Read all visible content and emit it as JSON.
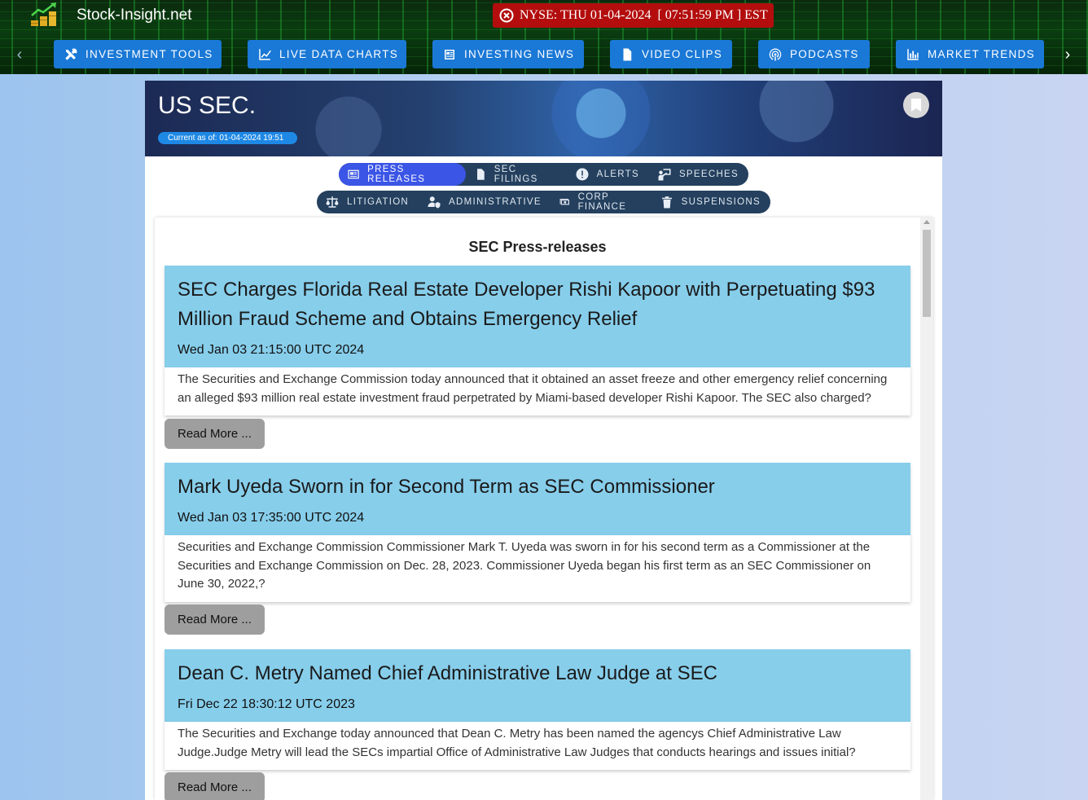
{
  "header": {
    "brand": "Stock-Insight.net",
    "clock_text": "NYSE: THU 01-04-2024  [ 07:51:59 PM ] EST",
    "colors": {
      "clock_bg": "#b30d0d",
      "nav_button": "#1a78d6"
    }
  },
  "nav": {
    "left_arrow": "‹",
    "right_arrow": "›",
    "items": [
      {
        "label": "Investment Tools",
        "icon": "tools-icon"
      },
      {
        "label": "Live Data Charts",
        "icon": "line-chart-icon"
      },
      {
        "label": "Investing News",
        "icon": "newspaper-icon"
      },
      {
        "label": "Video Clips",
        "icon": "video-file-icon"
      },
      {
        "label": "Podcasts",
        "icon": "podcast-icon"
      },
      {
        "label": "Market Trends",
        "icon": "bar-chart-icon"
      }
    ]
  },
  "page": {
    "title": "US SEC.",
    "as_of": "Current as of: 01-04-2024 19:51"
  },
  "tabs": {
    "row1": [
      {
        "label": "Press Releases",
        "icon": "newspaper-icon",
        "active": true
      },
      {
        "label": "SEC Filings",
        "icon": "file-upload-icon",
        "active": false
      },
      {
        "label": "Alerts",
        "icon": "alert-icon",
        "active": false
      },
      {
        "label": "Speeches",
        "icon": "speaker-icon",
        "active": false
      }
    ],
    "row2": [
      {
        "label": "Litigation",
        "icon": "scale-icon",
        "active": false
      },
      {
        "label": "Administrative",
        "icon": "user-shield-icon",
        "active": false
      },
      {
        "label": "Corp Finance",
        "icon": "cash-icon",
        "active": false
      },
      {
        "label": "Suspensions",
        "icon": "trash-icon",
        "active": false
      }
    ]
  },
  "feed": {
    "title": "SEC Press-releases",
    "read_more_label": "Read More ...",
    "items": [
      {
        "title": "SEC Charges Florida Real Estate Developer Rishi Kapoor with Perpetuating $93 Million Fraud Scheme and Obtains Emergency Relief",
        "date": "Wed Jan 03 21:15:00 UTC 2024",
        "summary": "The Securities and Exchange Commission today announced that it obtained an asset freeze and other emergency relief concerning an alleged $93 million real estate investment fraud perpetrated by Miami-based developer Rishi Kapoor. The SEC also charged?"
      },
      {
        "title": "Mark Uyeda Sworn in for Second Term as SEC Commissioner",
        "date": "Wed Jan 03 17:35:00 UTC 2024",
        "summary": "Securities and Exchange Commission Commissioner Mark T. Uyeda was sworn in for his second term as a Commissioner at the Securities and Exchange Commission on Dec. 28, 2023. Commissioner Uyeda began his first term as an SEC Commissioner on June 30, 2022,?"
      },
      {
        "title": "Dean C. Metry Named Chief Administrative Law Judge at SEC",
        "date": "Fri Dec 22 18:30:12 UTC 2023",
        "summary": "The Securities and Exchange today announced that Dean C. Metry has been named the agencys Chief Administrative Law Judge.Judge Metry will lead the SECs impartial Office of Administrative Law Judges that conducts hearings and issues initial?"
      }
    ]
  }
}
